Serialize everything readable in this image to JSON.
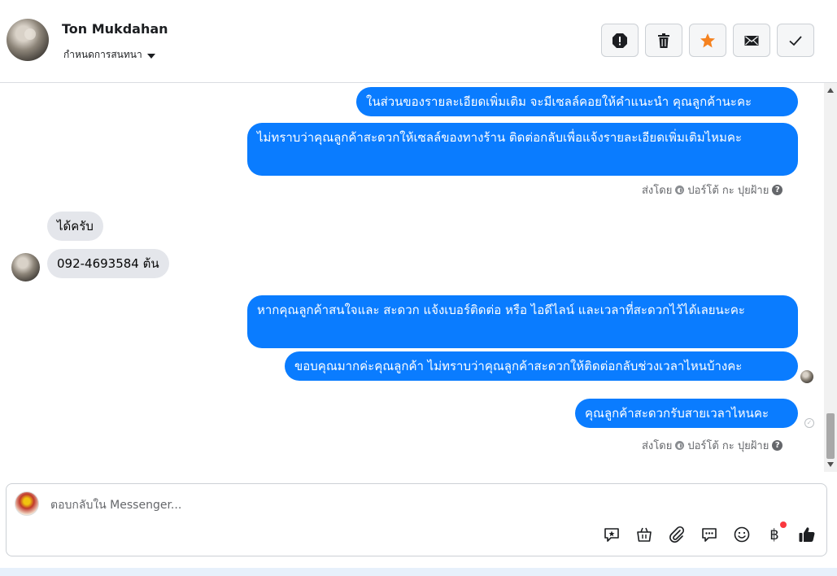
{
  "header": {
    "contact_name": "Ton Mukdahan",
    "conversation_settings_label": "กำหนดการสนทนา",
    "actions": [
      {
        "name": "report-button",
        "icon": "alert-icon"
      },
      {
        "name": "delete-button",
        "icon": "trash-icon"
      },
      {
        "name": "star-button",
        "icon": "star-icon"
      },
      {
        "name": "mark-unread-button",
        "icon": "envelope-icon"
      },
      {
        "name": "mark-done-button",
        "icon": "check-icon"
      }
    ]
  },
  "messages": [
    {
      "text": "ในส่วนของรายละเอียดเพิ่มเติม จะมีเซลล์คอยให้คำแนะนำ คุณลูกค้านะคะ",
      "from": "page"
    },
    {
      "text": "ไม่ทราบว่าคุณลูกค้าสะดวกให้เซลล์ของทางร้าน ติดต่อกลับเพื่อแจ้งรายละเอียดเพิ่มเติมไหมคะ",
      "from": "page"
    },
    {
      "text": "ได้ครับ",
      "from": "customer"
    },
    {
      "text": "092-4693584 ต้น",
      "from": "customer"
    },
    {
      "text": "หากคุณลูกค้าสนใจและ สะดวก แจ้งเบอร์ติดต่อ หรือ ไอดีไลน์ และเวลาที่สะดวกไว้ได้เลยนะคะ",
      "from": "page"
    },
    {
      "text": "ขอบคุณมากค่ะคุณลูกค้า ไม่ทราบว่าคุณลูกค้าสะดวกให้ติดต่อกลับช่วงเวลาไหนบ้างคะ",
      "from": "page"
    },
    {
      "text": "คุณลูกค้าสะดวกรับสายเวลาไหนคะ",
      "from": "page"
    }
  ],
  "sent_by": {
    "prefix": "ส่งโดย",
    "sender": "ปอร์โต้ กะ ปุยฝ้าย",
    "help": "?"
  },
  "composer": {
    "placeholder": "ตอบกลับใน Messenger...",
    "baht_symbol": "฿"
  },
  "colors": {
    "outgoing_bubble": "#0a7cff",
    "incoming_bubble": "#e4e6eb",
    "star": "#f5821f"
  }
}
